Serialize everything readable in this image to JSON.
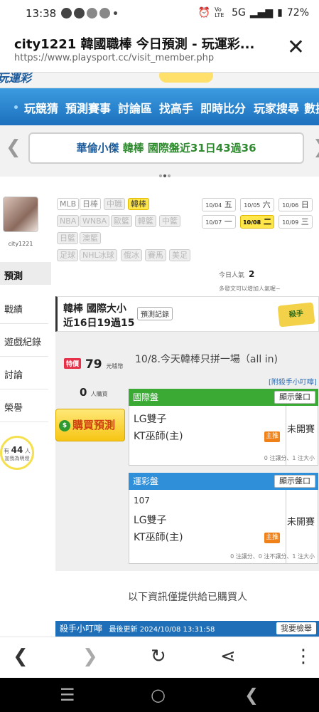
{
  "status": {
    "time": "13:38",
    "net": "5G",
    "battery": "72%",
    "lte": "Vo LTE"
  },
  "browser": {
    "title": "city1221 韓國職棒 今日預測 - 玩運彩...",
    "url": "https://www.playsport.cc/visit_member.php"
  },
  "nav": {
    "items": [
      "玩競猜",
      "預測賽事",
      "討論區",
      "找高手",
      "即時比分",
      "玩家搜尋",
      "數据"
    ]
  },
  "banner": {
    "part1": "華倫小傑",
    "part2": "韓棒 國際盤近31日43過36"
  },
  "sidebar": {
    "username": "city1221",
    "items": [
      "預測",
      "戰績",
      "遊戲紀錄",
      "討論",
      "榮譽"
    ],
    "bubble_prefix": "有",
    "bubble_count": "44",
    "bubble_unit": "人",
    "bubble_text": "加我為明燈"
  },
  "filters": {
    "row1": [
      "MLB",
      "日棒",
      "中職",
      "韓棒"
    ],
    "row2": [
      "NBA",
      "WNBA",
      "歐籃",
      "韓籃",
      "中籃"
    ],
    "row3": [
      "日籃",
      "澳籃"
    ],
    "row4": [
      "足球",
      "NHL冰球",
      "俄冰",
      "賽馬",
      "美足"
    ]
  },
  "dates": {
    "row1": [
      {
        "d": "10/04",
        "w": "五"
      },
      {
        "d": "10/05",
        "w": "六"
      },
      {
        "d": "10/06",
        "w": "日"
      }
    ],
    "row2": [
      {
        "d": "10/07",
        "w": "一"
      },
      {
        "d": "10/08",
        "w": "二"
      },
      {
        "d": "10/09",
        "w": "三"
      }
    ]
  },
  "popularity": {
    "label": "今日人氣",
    "value": "2",
    "sub": "多發文可以增加人氣喔~"
  },
  "record": {
    "line1": "韓棒 國際大小",
    "line2": "近16日19過15",
    "button": "預測記錄",
    "logo": "殺手"
  },
  "price": {
    "badge": "特價",
    "value": "79",
    "unit": "元噱幣"
  },
  "buyers": {
    "value": "0",
    "unit": "人購買"
  },
  "buy_button": "購買預測",
  "headline": "10/8.今天韓棒只拼一場（all in)",
  "tip_link": "[附殺手小叮嚀]",
  "panel1": {
    "title": "國際盤",
    "show": "顯示盤口",
    "team1": "LG雙子",
    "team2": "KT巫師(主)",
    "tag": "主推",
    "status": "未開賽",
    "note": "0 注讓分、1 注大小"
  },
  "panel2": {
    "title": "運彩盤",
    "show": "顯示盤口",
    "code": "107",
    "team1": "LG雙子",
    "team2": "KT巫師(主)",
    "tag": "主推",
    "status": "未開賽",
    "note": "0 注讓分、0 注不讓分、1 注大小"
  },
  "info": "以下資訊僅提供給已購買人",
  "killer": {
    "title": "殺手小叮嚀",
    "updated": "最後更新 2024/10/08 13:31:58",
    "report": "我要檢舉"
  },
  "colors": {
    "nav_blue": "#1d70bd",
    "green_head": "#3aaa35",
    "blue_head": "#2f8fd8",
    "accent_yellow": "#ffe64a"
  }
}
